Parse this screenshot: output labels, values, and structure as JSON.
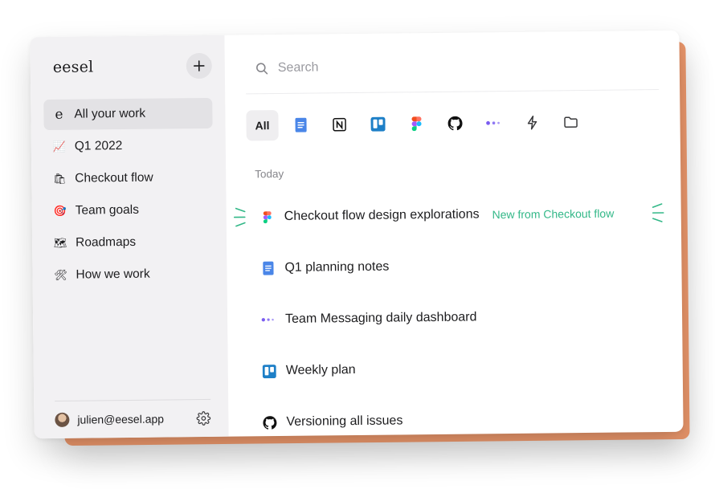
{
  "sidebar": {
    "brand": "eesel",
    "add_icon": "plus-icon",
    "items": [
      {
        "label": "All your work",
        "icon": "e",
        "active": true
      },
      {
        "label": "Q1 2022",
        "icon": "📈"
      },
      {
        "label": "Checkout flow",
        "icon": "🛍"
      },
      {
        "label": "Team goals",
        "icon": "🎯"
      },
      {
        "label": "Roadmaps",
        "icon": "🗺"
      },
      {
        "label": "How we work",
        "icon": "🛠"
      }
    ],
    "footer": {
      "email": "julien@eesel.app",
      "settings_icon": "gear-icon"
    }
  },
  "search": {
    "placeholder": "Search",
    "value": ""
  },
  "filters": {
    "all_label": "All",
    "items": [
      "google-docs-icon",
      "notion-icon",
      "trello-icon",
      "figma-icon",
      "github-icon",
      "messaging-dots-icon",
      "bolt-icon",
      "folder-icon"
    ]
  },
  "results": {
    "section": "Today",
    "items": [
      {
        "title": "Checkout flow design explorations",
        "icon": "figma-icon",
        "note": "New from Checkout flow"
      },
      {
        "title": "Q1 planning notes",
        "icon": "google-docs-icon"
      },
      {
        "title": "Team Messaging daily dashboard",
        "icon": "messaging-dots-icon"
      },
      {
        "title": "Weekly plan",
        "icon": "trello-icon"
      },
      {
        "title": "Versioning all issues",
        "icon": "github-icon"
      }
    ]
  },
  "colors": {
    "accent_orange": "#e8956a",
    "note_green": "#33b888",
    "sidebar_bg": "#f2f1f3",
    "docs_blue": "#4a86e8",
    "trello_blue": "#1d7fc7",
    "dots_purple": "#7a5cf0"
  }
}
